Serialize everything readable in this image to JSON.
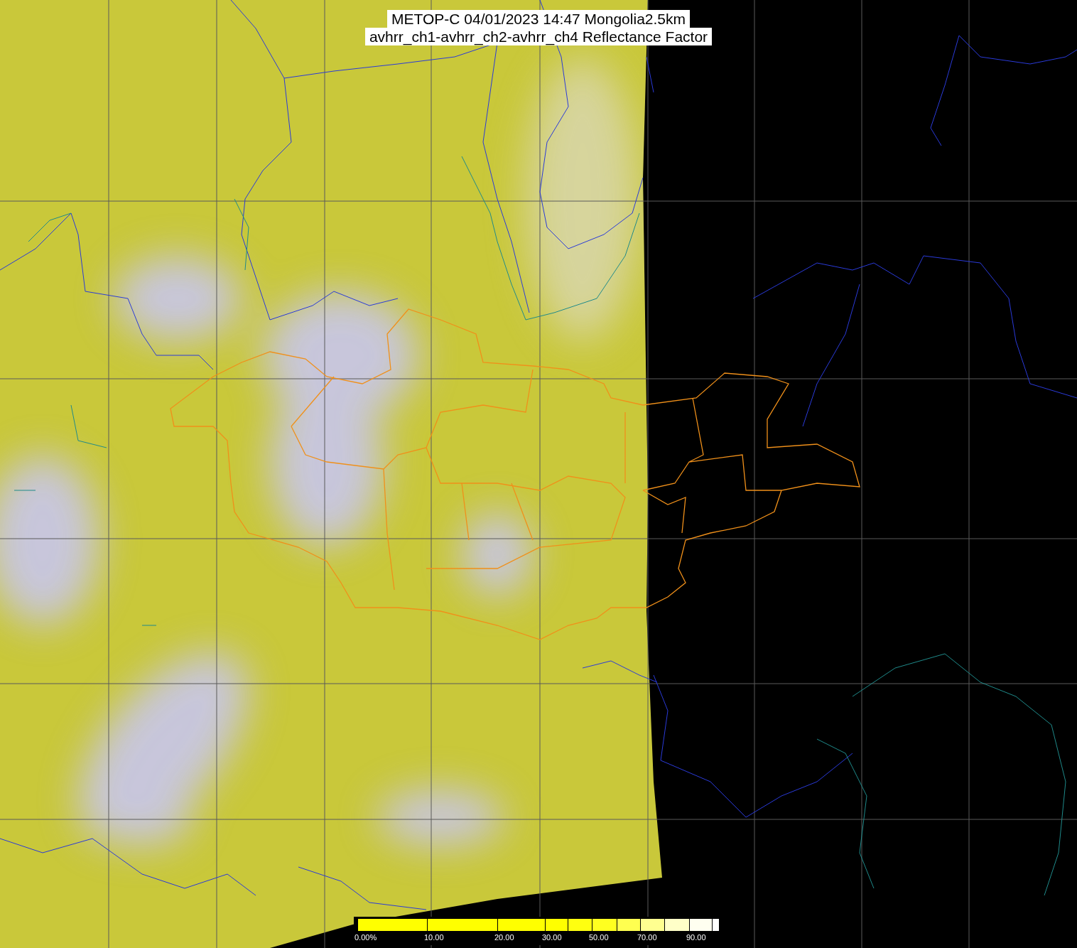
{
  "title": {
    "lines": [
      "METOP-C 04/01/2023 14:47 Mongolia2.5km",
      "avhrr_ch1-avhrr_ch2-avhrr_ch4 Reflectance Factor"
    ]
  },
  "colorbar": {
    "segments": [
      {
        "color": "#ffff00",
        "label": "0.00%"
      },
      {
        "color": "#ffff00",
        "label": "10.00"
      },
      {
        "color": "#ffff00",
        "label": "20.00"
      },
      {
        "color": "#ffff00",
        "label": "30.00"
      },
      {
        "color": "#ffff10"
      },
      {
        "color": "#ffff20",
        "label": "50.00"
      },
      {
        "color": "#ffff50"
      },
      {
        "color": "#ffff90",
        "label": "70.00"
      },
      {
        "color": "#ffffc8"
      },
      {
        "color": "#fffff0",
        "label": "90.00"
      },
      {
        "color": "#ffffff"
      }
    ]
  }
}
